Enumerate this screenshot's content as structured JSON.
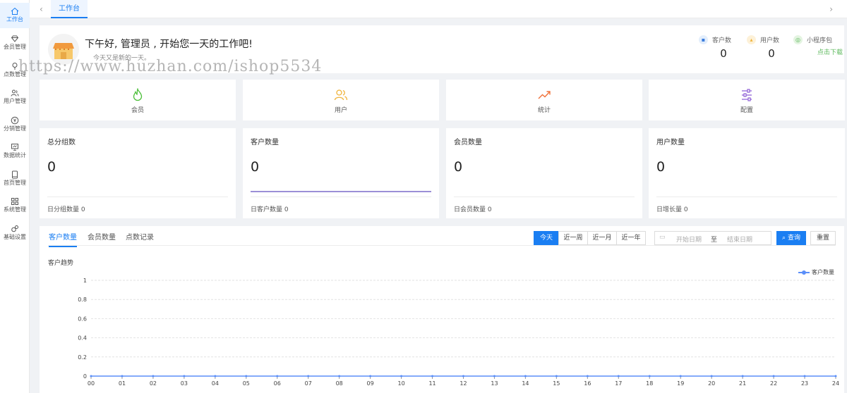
{
  "sidebar": {
    "items": [
      {
        "label": "工作台",
        "icon": "home-icon",
        "active": true
      },
      {
        "label": "会员管理",
        "icon": "diamond-icon",
        "active": false
      },
      {
        "label": "点数管理",
        "icon": "pin-icon",
        "active": false
      },
      {
        "label": "用户管理",
        "icon": "users-icon",
        "active": false
      },
      {
        "label": "分销管理",
        "icon": "coin-icon",
        "active": false
      },
      {
        "label": "数据统计",
        "icon": "presentation-icon",
        "active": false
      },
      {
        "label": "首页管理",
        "icon": "tablet-icon",
        "active": false
      },
      {
        "label": "系统管理",
        "icon": "grid-icon",
        "active": false
      },
      {
        "label": "基础设置",
        "icon": "gears-icon",
        "active": false
      }
    ]
  },
  "tabbar": {
    "active_tab": "工作台",
    "left_arrow": "‹",
    "right_arrow": "›"
  },
  "welcome": {
    "greeting": "下午好, 管理员 , 开始您一天的工作吧!",
    "subtitle": "今天又是新的一天。"
  },
  "header_stats": [
    {
      "label": "客户数",
      "value": "0",
      "color": "#3b7ddd"
    },
    {
      "label": "用户数",
      "value": "0",
      "color": "#f0b43c"
    },
    {
      "label": "小程序包",
      "link": "点击下载",
      "color": "#5cb85c"
    }
  ],
  "watermark": "https://www.huzhan.com/ishop5534",
  "shortcuts": [
    {
      "label": "会员",
      "icon": "flame-icon",
      "color": "#4cbf3a"
    },
    {
      "label": "用户",
      "icon": "people-icon",
      "color": "#f0b43c"
    },
    {
      "label": "统计",
      "icon": "trend-icon",
      "color": "#f0733c"
    },
    {
      "label": "配置",
      "icon": "sliders-icon",
      "color": "#8e5fd6"
    }
  ],
  "stat_cards": [
    {
      "title": "总分组数",
      "value": "0",
      "footer": "日分组数量 0"
    },
    {
      "title": "客户数量",
      "value": "0",
      "footer": "日客户数量 0"
    },
    {
      "title": "会员数量",
      "value": "0",
      "footer": "日会员数量 0"
    },
    {
      "title": "用户数量",
      "value": "0",
      "footer": "日增长量 0"
    }
  ],
  "panel": {
    "tabs": [
      "客户数量",
      "会员数量",
      "点数记录"
    ],
    "active_tab": "客户数量",
    "ranges": [
      "今天",
      "近一周",
      "近一月",
      "近一年"
    ],
    "active_range": "今天",
    "start_placeholder": "开始日期",
    "range_separator": "至",
    "end_placeholder": "结束日期",
    "query_label": "查询",
    "reset_label": "重置"
  },
  "chart_data": {
    "type": "line",
    "title": "客户趋势",
    "series": [
      {
        "name": "客户数量",
        "values": [
          0,
          0,
          0,
          0,
          0,
          0,
          0,
          0,
          0,
          0,
          0,
          0,
          0,
          0,
          0,
          0,
          0,
          0,
          0,
          0,
          0,
          0,
          0,
          0,
          0
        ]
      }
    ],
    "x": [
      "00",
      "01",
      "02",
      "03",
      "04",
      "05",
      "06",
      "07",
      "08",
      "09",
      "10",
      "11",
      "12",
      "13",
      "14",
      "15",
      "16",
      "17",
      "18",
      "19",
      "20",
      "21",
      "22",
      "23",
      "24"
    ],
    "y_ticks": [
      "0",
      "0.2",
      "0.4",
      "0.6",
      "0.8",
      "1"
    ],
    "ylim": [
      0,
      1
    ],
    "grid": true,
    "legend": "top-right",
    "line_color": "#5b8ff9"
  }
}
